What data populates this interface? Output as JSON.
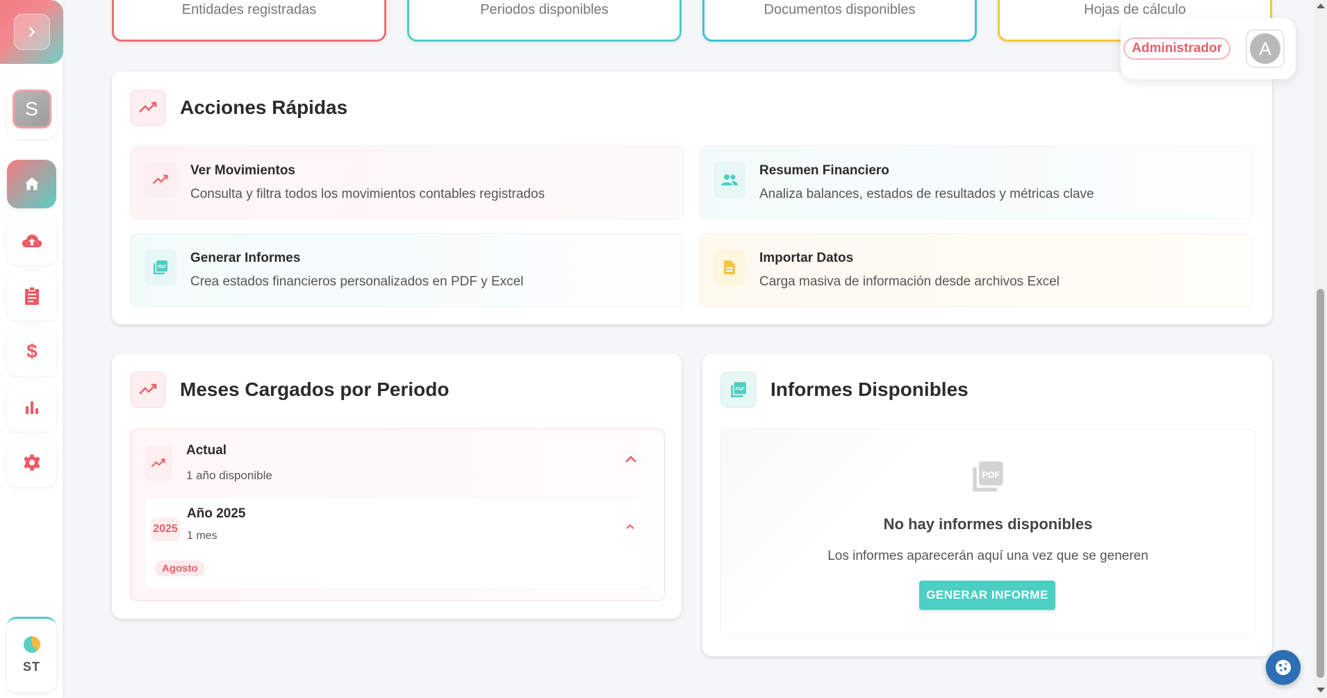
{
  "sidebar": {
    "avatar_initial": "S",
    "user_initials": "ST",
    "items": [
      {
        "name": "home",
        "active": true
      },
      {
        "name": "upload"
      },
      {
        "name": "clipboard"
      },
      {
        "name": "dollar"
      },
      {
        "name": "chart"
      },
      {
        "name": "settings"
      }
    ]
  },
  "stats": [
    {
      "label": "Entidades registradas",
      "color": "#ef6f78"
    },
    {
      "label": "Periodos disponibles",
      "color": "#4ccfc2"
    },
    {
      "label": "Documentos disponibles",
      "color": "#3cc2d8"
    },
    {
      "label": "Hojas de cálculo",
      "color": "#f4c542"
    }
  ],
  "header": {
    "role": "Administrador",
    "avatar_initial": "A"
  },
  "quick_actions": {
    "title": "Acciones Rápidas",
    "items": [
      {
        "title": "Ver Movimientos",
        "desc": "Consulta y filtra todos los movimientos contables registrados"
      },
      {
        "title": "Resumen Financiero",
        "desc": "Analiza balances, estados de resultados y métricas clave"
      },
      {
        "title": "Generar Informes",
        "desc": "Crea estados financieros personalizados en PDF y Excel"
      },
      {
        "title": "Importar Datos",
        "desc": "Carga masiva de información desde archivos Excel"
      }
    ]
  },
  "months": {
    "title": "Meses Cargados por Periodo",
    "group": {
      "title": "Actual",
      "subtitle": "1 año disponible",
      "year": {
        "badge": "2025",
        "title": "Año 2025",
        "subtitle": "1 mes",
        "months": [
          "Agosto"
        ]
      }
    }
  },
  "reports": {
    "title": "Informes Disponibles",
    "empty_title": "No hay informes disponibles",
    "empty_desc": "Los informes aparecerán aquí una vez que se generen",
    "button": "GENERAR INFORME"
  },
  "colors": {
    "accent_pink": "#ef6f78",
    "accent_teal": "#4ccfc2",
    "accent_yellow": "#f4c542"
  }
}
